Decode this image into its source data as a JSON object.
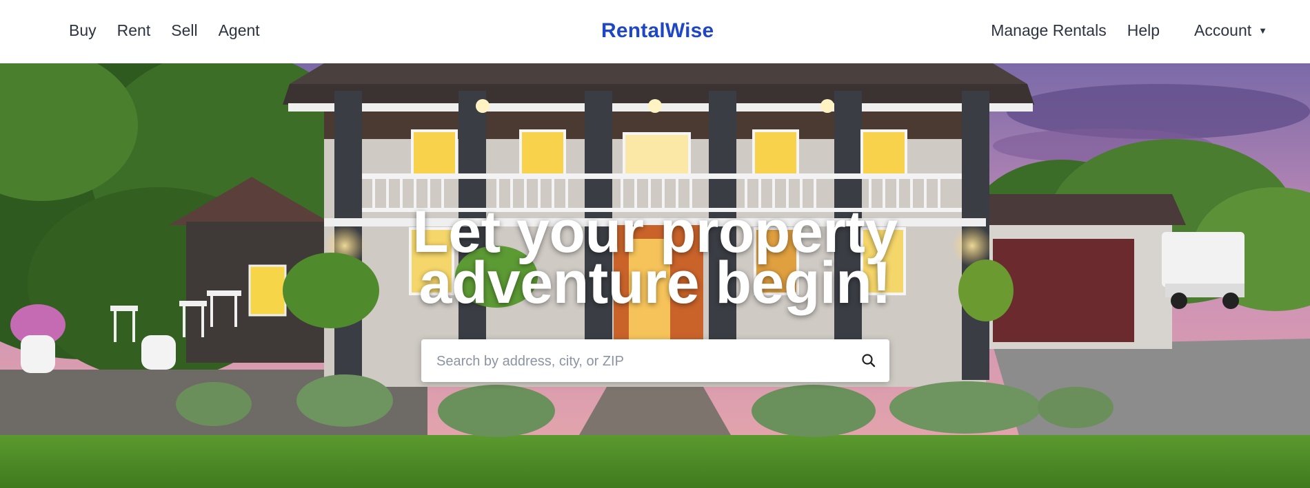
{
  "nav": {
    "left_links": [
      "Buy",
      "Rent",
      "Sell",
      "Agent"
    ],
    "brand": "RentalWise",
    "right_links": [
      "Manage Rentals",
      "Help"
    ],
    "account_label": "Account",
    "account_caret": "▼"
  },
  "hero": {
    "headline_line1": "Let your property",
    "headline_line2": "adventure begin!",
    "image": "house-at-dusk-photo"
  },
  "search": {
    "placeholder": "Search by address, city, or ZIP",
    "value": "",
    "icon": "search-icon"
  },
  "colors": {
    "brand": "#1f47c4",
    "nav_text": "#2b3440",
    "headline_text": "#ffffff"
  }
}
